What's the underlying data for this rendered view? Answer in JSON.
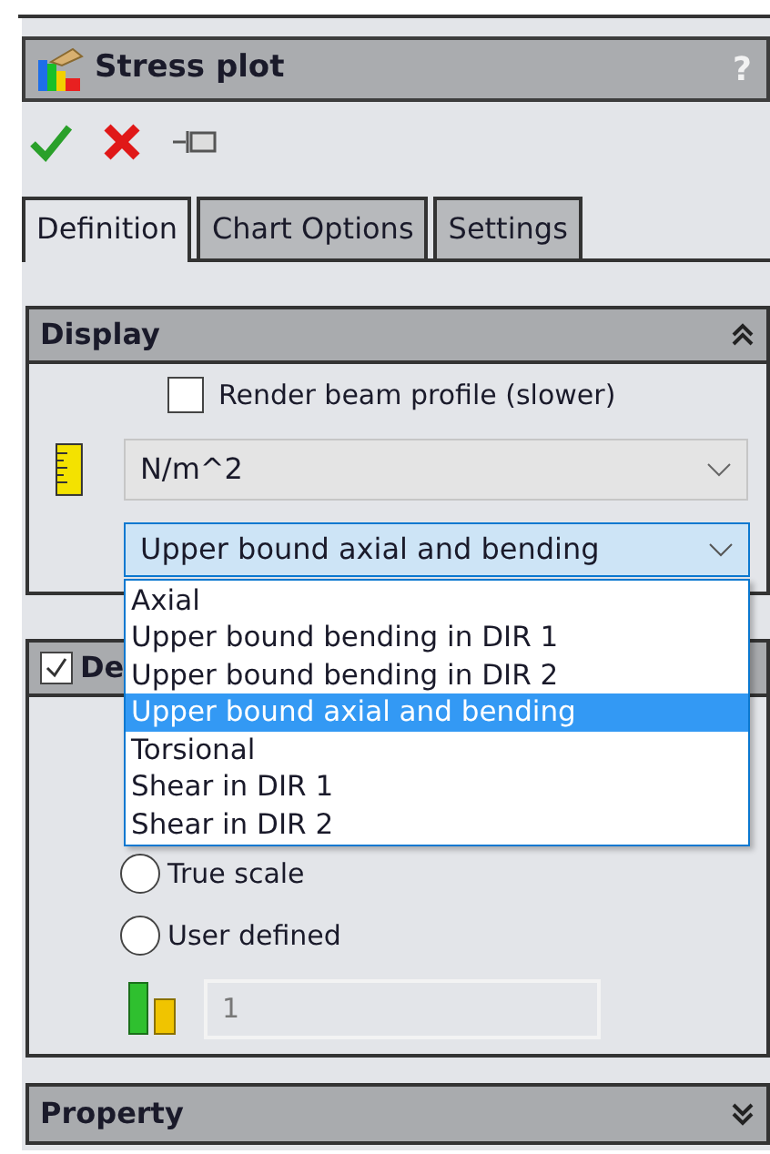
{
  "window": {
    "title": "Stress plot",
    "help": "?"
  },
  "toolbar": [
    {
      "kind": "ok"
    },
    {
      "kind": "cancel"
    },
    {
      "kind": "pin"
    }
  ],
  "tabs": [
    {
      "label": "Definition",
      "selected": true
    },
    {
      "label": "Chart Options",
      "selected": false
    },
    {
      "label": "Settings",
      "selected": false
    }
  ],
  "display": {
    "title": "Display",
    "expanded": true,
    "render_beam_profile": {
      "label": "Render beam profile (slower)",
      "checked": false
    },
    "units": {
      "value": "N/m^2"
    },
    "stress_type": {
      "value": "Upper bound axial and bending",
      "open": true,
      "options": [
        {
          "label": "Axial",
          "selected": false
        },
        {
          "label": "Upper bound bending in DIR 1",
          "selected": false
        },
        {
          "label": "Upper bound bending in DIR 2",
          "selected": false
        },
        {
          "label": "Upper bound axial and bending",
          "selected": true
        },
        {
          "label": "Torsional",
          "selected": false
        },
        {
          "label": "Shear in DIR 1",
          "selected": false
        },
        {
          "label": "Shear in DIR 2",
          "selected": false
        }
      ]
    }
  },
  "deformed": {
    "title": "De",
    "checked": true,
    "options": [
      {
        "label": "True scale",
        "selected": false
      },
      {
        "label": "User defined",
        "selected": false
      }
    ],
    "scale_field": {
      "value": "1",
      "disabled": true
    }
  },
  "property": {
    "title": "Property",
    "expanded": false
  }
}
